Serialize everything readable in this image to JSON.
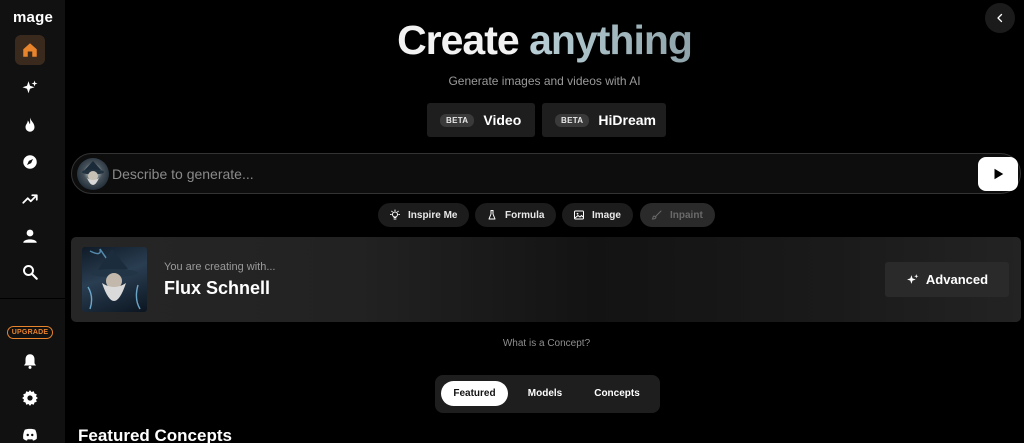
{
  "sidebar": {
    "logo": "mage",
    "nav": [
      {
        "name": "home",
        "icon": "home-icon",
        "active": true
      },
      {
        "name": "create",
        "icon": "sparkles-icon"
      },
      {
        "name": "hot",
        "icon": "flame-icon"
      },
      {
        "name": "explore",
        "icon": "compass-icon"
      },
      {
        "name": "trending",
        "icon": "trending-up-icon"
      },
      {
        "name": "profile",
        "icon": "user-icon"
      },
      {
        "name": "search",
        "icon": "search-icon"
      }
    ],
    "upgrade_label": "UPGRADE",
    "bottom": [
      {
        "name": "notifications",
        "icon": "bell-icon"
      },
      {
        "name": "settings",
        "icon": "gear-icon"
      },
      {
        "name": "discord",
        "icon": "discord-icon"
      }
    ]
  },
  "hero": {
    "title_part1": "Create",
    "title_part2": "anything",
    "subtitle": "Generate images and videos with AI"
  },
  "model_buttons": [
    {
      "badge": "BETA",
      "label": "Video"
    },
    {
      "badge": "BETA",
      "label": "HiDream"
    }
  ],
  "prompt": {
    "placeholder": "Describe to generate..."
  },
  "chips": [
    {
      "label": "Inspire Me",
      "icon": "lightbulb-icon",
      "disabled": false
    },
    {
      "label": "Formula",
      "icon": "flask-icon",
      "disabled": false
    },
    {
      "label": "Image",
      "icon": "image-icon",
      "disabled": false
    },
    {
      "label": "Inpaint",
      "icon": "brush-icon",
      "disabled": true
    }
  ],
  "concept": {
    "caption": "You are creating with...",
    "name": "Flux Schnell",
    "advanced_label": "Advanced"
  },
  "what_is_concept": "What is a Concept?",
  "tabs": [
    {
      "label": "Featured",
      "active": true
    },
    {
      "label": "Models",
      "active": false
    },
    {
      "label": "Concepts",
      "active": false
    }
  ],
  "section_title": "Featured Concepts",
  "colors": {
    "accent_upgrade": "#e8842c",
    "active_nav_bg": "#3a2a1e"
  }
}
